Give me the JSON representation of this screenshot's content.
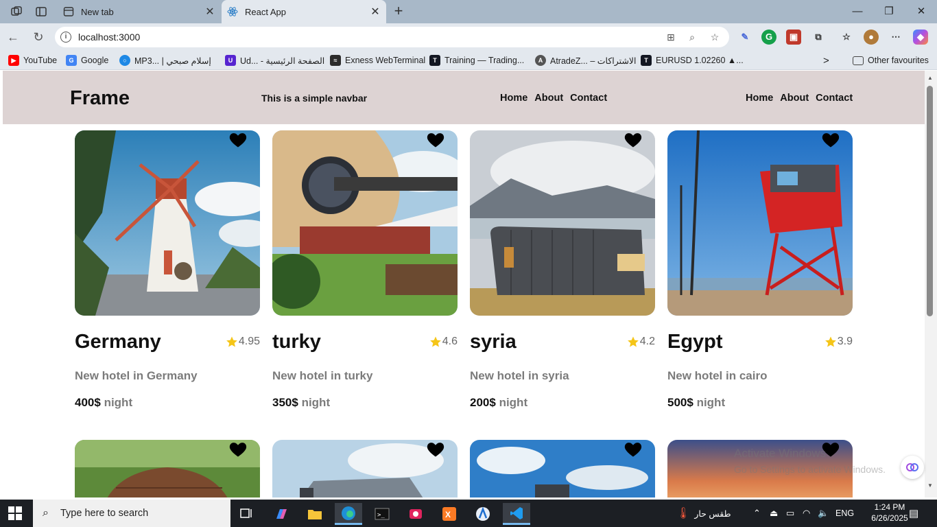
{
  "browser": {
    "tabs": [
      {
        "title": "New tab",
        "active": false
      },
      {
        "title": "React App",
        "active": true
      }
    ],
    "new_tab_label": "+",
    "address": "localhost:3000",
    "window_controls": {
      "minimize": "—",
      "maximize": "❐",
      "close": "✕"
    }
  },
  "favorites": {
    "items": [
      {
        "label": "YouTube",
        "color": "#ff0000"
      },
      {
        "label": "Google",
        "color": "#4285f4"
      },
      {
        "label": "MP3... | إسلام صبحي",
        "color": "#1e88e5"
      },
      {
        "label": "Ud... - الصفحة الرئيسية",
        "color": "#5624d0"
      },
      {
        "label": "Exness WebTerminal",
        "color": "#2b2b2b"
      },
      {
        "label": "Training — Trading...",
        "color": "#131722"
      },
      {
        "label": "AtradeZ... – الاشتراكات",
        "color": "#555555"
      },
      {
        "label": "EURUSD 1.02260 ▲...",
        "color": "#131722"
      }
    ],
    "more": ">",
    "other": "Other favourites"
  },
  "navbar": {
    "brand": "Frame",
    "tagline": "This is a simple navbar",
    "links_a": [
      "Home",
      "About",
      "Contact"
    ],
    "links_b": [
      "Home",
      "About",
      "Contact"
    ]
  },
  "cards": [
    {
      "name": "Germany",
      "rating": "4.95",
      "desc": "New hotel in Germany",
      "price": "400$",
      "unit": "night"
    },
    {
      "name": "turky",
      "rating": "4.6",
      "desc": "New hotel in turky",
      "price": "350$",
      "unit": "night"
    },
    {
      "name": "syria",
      "rating": "4.2",
      "desc": "New hotel in syria",
      "price": "200$",
      "unit": "night"
    },
    {
      "name": "Egypt",
      "rating": "3.9",
      "desc": "New hotel in cairo",
      "price": "500$",
      "unit": "night"
    }
  ],
  "watermark": {
    "line1": "Activate Windows",
    "line2": "Go to Settings to activate Windows."
  },
  "taskbar": {
    "search_placeholder": "Type here to search",
    "weather": "طقس حار",
    "language": "ENG",
    "time": "1:24 PM",
    "date": "6/26/2025"
  },
  "colors": {
    "navbar_bg": "#ddd3d3",
    "star": "#f5c518",
    "taskbar_bg": "#1c1f24"
  }
}
